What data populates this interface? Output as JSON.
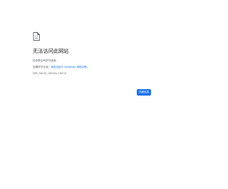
{
  "error": {
    "title": "无法访问此网站",
    "message_line1": "检查是否有拼写错误。",
    "message_line2_prefix": "如果拼写无误，",
    "diagnostics_link": "请尝试运行 Windows 网络诊断",
    "message_line2_suffix": "。",
    "error_code": "ERR_FAILED_ORIGIN_CHECK",
    "details_button": "详细信息",
    "icon": "sad-page-icon"
  },
  "colors": {
    "background": "#ffffff",
    "title_text": "#202124",
    "body_text": "#5f6368",
    "accent": "#1a73e8"
  }
}
